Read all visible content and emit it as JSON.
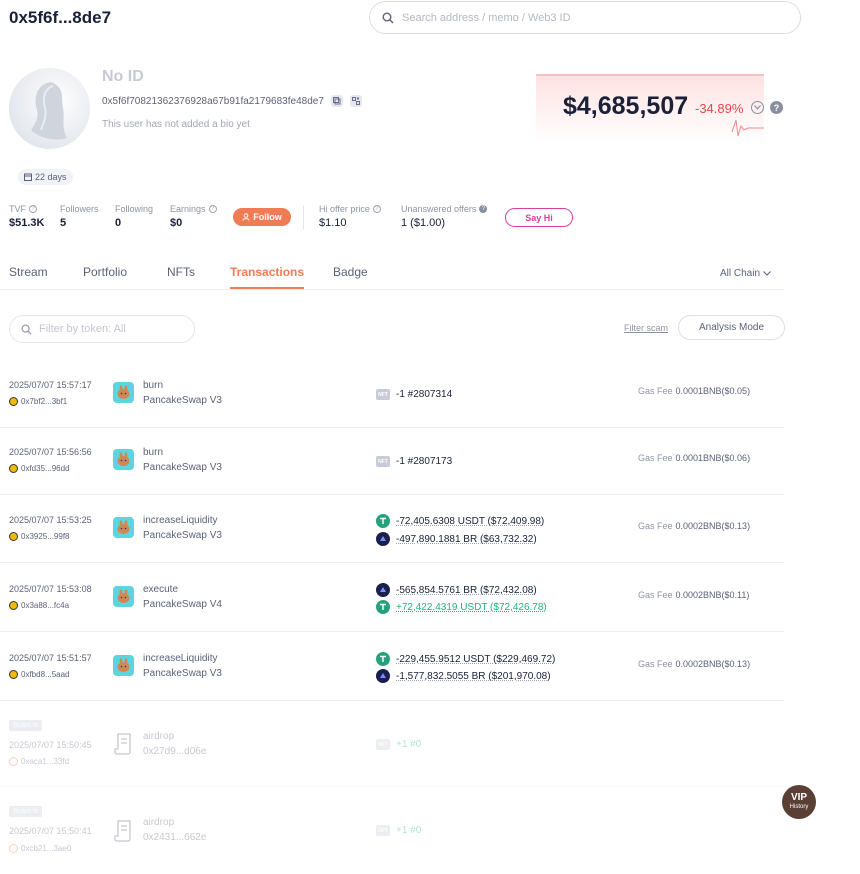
{
  "header": {
    "address_short": "0x5f6f...8de7",
    "search_placeholder": "Search address / memo / Web3 ID"
  },
  "profile": {
    "name": "No ID",
    "address_full": "0x5f6f70821362376928a67b91fa2179683fe48de7",
    "bio": "This user has not added a bio yet",
    "days_badge": "22 days"
  },
  "networth": {
    "value": "$4,685,507",
    "change": "-34.89%",
    "change_color": "#e5484d"
  },
  "stats": {
    "tvf_label": "TVF",
    "tvf_value": "$51.3K",
    "followers_label": "Followers",
    "followers_value": "5",
    "following_label": "Following",
    "following_value": "0",
    "earnings_label": "Earnings",
    "earnings_value": "$0",
    "follow_button": "Follow",
    "hi_offer_label": "Hi offer price",
    "hi_offer_value": "$1.10",
    "unanswered_label": "Unanswered offers",
    "unanswered_value": "1 ($1.00)",
    "say_hi_button": "Say Hi"
  },
  "tabs": {
    "stream": "Stream",
    "portfolio": "Portfolio",
    "nfts": "NFTs",
    "transactions": "Transactions",
    "badge": "Badge",
    "active": "Transactions",
    "chain": "All Chain"
  },
  "filters": {
    "token_placeholder": "Filter by token: All",
    "filter_scam": "Filter scam",
    "analysis_mode": "Analysis Mode"
  },
  "transactions": [
    {
      "time": "2025/07/07 15:57:17",
      "from": "0x7bf2...3bf1",
      "method": "burn",
      "app": "PancakeSwap V3",
      "token1": "-1 #2807314",
      "gas_label": "Gas Fee",
      "gas": "0.0001BNB($0.05)"
    },
    {
      "time": "2025/07/07 15:56:56",
      "from": "0xfd35...96dd",
      "method": "burn",
      "app": "PancakeSwap V3",
      "token1": "-1 #2807173",
      "gas_label": "Gas Fee",
      "gas": "0.0001BNB($0.06)"
    },
    {
      "time": "2025/07/07 15:53:25",
      "from": "0x3925...99f8",
      "method": "increaseLiquidity",
      "app": "PancakeSwap V3",
      "token1": "-72,405.6308 USDT ($72,409.98)",
      "token2": "-497,890.1881 BR ($63,732.32)",
      "gas_label": "Gas Fee",
      "gas": "0.0002BNB($0.13)"
    },
    {
      "time": "2025/07/07 15:53:08",
      "from": "0x3a88...fc4a",
      "method": "execute",
      "app": "PancakeSwap V4",
      "token1": "-565,854.5761 BR ($72,432.08)",
      "token2": "+72,422.4319 USDT ($72,426.78)",
      "gas_label": "Gas Fee",
      "gas": "0.0002BNB($0.11)"
    },
    {
      "time": "2025/07/07 15:51:57",
      "from": "0xfbd8...5aad",
      "method": "increaseLiquidity",
      "app": "PancakeSwap V3",
      "token1": "-229,455.9512 USDT ($229,469.72)",
      "token2": "-1,577,832.5055 BR ($201,970.08)",
      "gas_label": "Gas Fee",
      "gas": "0.0002BNB($0.13)"
    },
    {
      "scam_label": "Scam tx",
      "time": "2025/07/07 15:50:45",
      "from": "0xaca1...33fd",
      "method": "airdrop",
      "app": "0x27d9...d06e",
      "token1": "+1 #0"
    },
    {
      "scam_label": "Scam tx",
      "time": "2025/07/07 15:50:41",
      "from": "0xcb21...3ae0",
      "method": "airdrop",
      "app": "0x2431...662e",
      "token1": "+1 #0"
    }
  ],
  "vip": {
    "title": "VIP",
    "sub": "History"
  }
}
